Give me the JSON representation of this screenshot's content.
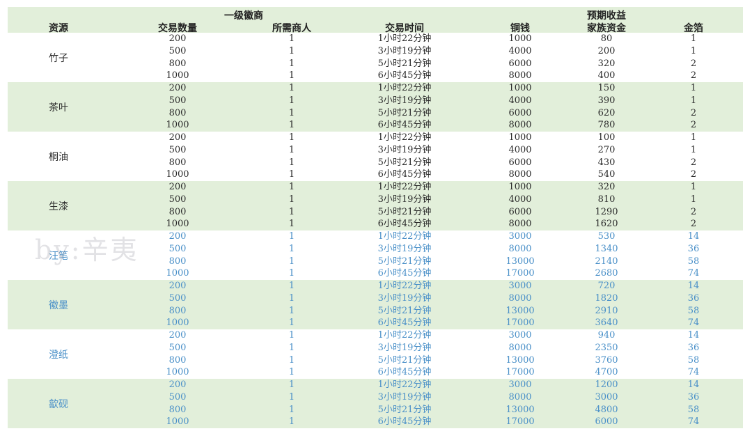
{
  "headers": {
    "group_top": "一级徽商",
    "income_top": "预期收益",
    "resource": "资源",
    "quantity": "交易数量",
    "merchants": "所需商人",
    "time": "交易时间",
    "copper": "铜钱",
    "family_fund": "家族资金",
    "gold": "金箔"
  },
  "watermark": "by:辛夷",
  "groups": [
    {
      "name": "竹子",
      "rows": [
        {
          "qty": "200",
          "merchants": "1",
          "time": "1小时22分钟",
          "copper": "1000",
          "family": "80",
          "gold": "1"
        },
        {
          "qty": "500",
          "merchants": "1",
          "time": "3小时19分钟",
          "copper": "4000",
          "family": "200",
          "gold": "1"
        },
        {
          "qty": "800",
          "merchants": "1",
          "time": "5小时21分钟",
          "copper": "6000",
          "family": "320",
          "gold": "2"
        },
        {
          "qty": "1000",
          "merchants": "1",
          "time": "6小时45分钟",
          "copper": "8000",
          "family": "400",
          "gold": "2"
        }
      ]
    },
    {
      "name": "茶叶",
      "rows": [
        {
          "qty": "200",
          "merchants": "1",
          "time": "1小时22分钟",
          "copper": "1000",
          "family": "150",
          "gold": "1"
        },
        {
          "qty": "500",
          "merchants": "1",
          "time": "3小时19分钟",
          "copper": "4000",
          "family": "390",
          "gold": "1"
        },
        {
          "qty": "800",
          "merchants": "1",
          "time": "5小时21分钟",
          "copper": "6000",
          "family": "620",
          "gold": "2"
        },
        {
          "qty": "1000",
          "merchants": "1",
          "time": "6小时45分钟",
          "copper": "8000",
          "family": "780",
          "gold": "2"
        }
      ]
    },
    {
      "name": "桐油",
      "rows": [
        {
          "qty": "200",
          "merchants": "1",
          "time": "1小时22分钟",
          "copper": "1000",
          "family": "100",
          "gold": "1"
        },
        {
          "qty": "500",
          "merchants": "1",
          "time": "3小时19分钟",
          "copper": "4000",
          "family": "270",
          "gold": "1"
        },
        {
          "qty": "800",
          "merchants": "1",
          "time": "5小时21分钟",
          "copper": "6000",
          "family": "430",
          "gold": "2"
        },
        {
          "qty": "1000",
          "merchants": "1",
          "time": "6小时45分钟",
          "copper": "8000",
          "family": "540",
          "gold": "2"
        }
      ]
    },
    {
      "name": "生漆",
      "rows": [
        {
          "qty": "200",
          "merchants": "1",
          "time": "1小时22分钟",
          "copper": "1000",
          "family": "320",
          "gold": "1"
        },
        {
          "qty": "500",
          "merchants": "1",
          "time": "3小时19分钟",
          "copper": "4000",
          "family": "810",
          "gold": "1"
        },
        {
          "qty": "800",
          "merchants": "1",
          "time": "5小时21分钟",
          "copper": "6000",
          "family": "1290",
          "gold": "2"
        },
        {
          "qty": "1000",
          "merchants": "1",
          "time": "6小时45分钟",
          "copper": "8000",
          "family": "1620",
          "gold": "2"
        }
      ]
    },
    {
      "name": "汪笔",
      "rows": [
        {
          "qty": "200",
          "merchants": "1",
          "time": "1小时22分钟",
          "copper": "3000",
          "family": "530",
          "gold": "14"
        },
        {
          "qty": "500",
          "merchants": "1",
          "time": "3小时19分钟",
          "copper": "8000",
          "family": "1340",
          "gold": "36"
        },
        {
          "qty": "800",
          "merchants": "1",
          "time": "5小时21分钟",
          "copper": "13000",
          "family": "2140",
          "gold": "58"
        },
        {
          "qty": "1000",
          "merchants": "1",
          "time": "6小时45分钟",
          "copper": "17000",
          "family": "2680",
          "gold": "74"
        }
      ]
    },
    {
      "name": "徽墨",
      "rows": [
        {
          "qty": "200",
          "merchants": "1",
          "time": "1小时22分钟",
          "copper": "3000",
          "family": "720",
          "gold": "14"
        },
        {
          "qty": "500",
          "merchants": "1",
          "time": "3小时19分钟",
          "copper": "8000",
          "family": "1820",
          "gold": "36"
        },
        {
          "qty": "800",
          "merchants": "1",
          "time": "5小时21分钟",
          "copper": "13000",
          "family": "2910",
          "gold": "58"
        },
        {
          "qty": "1000",
          "merchants": "1",
          "time": "6小时45分钟",
          "copper": "17000",
          "family": "3640",
          "gold": "74"
        }
      ]
    },
    {
      "name": "澄纸",
      "rows": [
        {
          "qty": "200",
          "merchants": "1",
          "time": "1小时22分钟",
          "copper": "3000",
          "family": "940",
          "gold": "14"
        },
        {
          "qty": "500",
          "merchants": "1",
          "time": "3小时19分钟",
          "copper": "8000",
          "family": "2350",
          "gold": "36"
        },
        {
          "qty": "800",
          "merchants": "1",
          "time": "5小时21分钟",
          "copper": "13000",
          "family": "3760",
          "gold": "58"
        },
        {
          "qty": "1000",
          "merchants": "1",
          "time": "6小时45分钟",
          "copper": "17000",
          "family": "4700",
          "gold": "74"
        }
      ]
    },
    {
      "name": "歙砚",
      "rows": [
        {
          "qty": "200",
          "merchants": "1",
          "time": "1小时22分钟",
          "copper": "3000",
          "family": "1200",
          "gold": "14"
        },
        {
          "qty": "500",
          "merchants": "1",
          "time": "3小时19分钟",
          "copper": "8000",
          "family": "3000",
          "gold": "36"
        },
        {
          "qty": "800",
          "merchants": "1",
          "time": "5小时21分钟",
          "copper": "13000",
          "family": "4800",
          "gold": "58"
        },
        {
          "qty": "1000",
          "merchants": "1",
          "time": "6小时45分钟",
          "copper": "17000",
          "family": "6000",
          "gold": "74"
        }
      ]
    }
  ],
  "colors": {
    "band": "#e2efda",
    "text_dark": "#2b2b2b",
    "text_blue": "#4a90c8"
  }
}
